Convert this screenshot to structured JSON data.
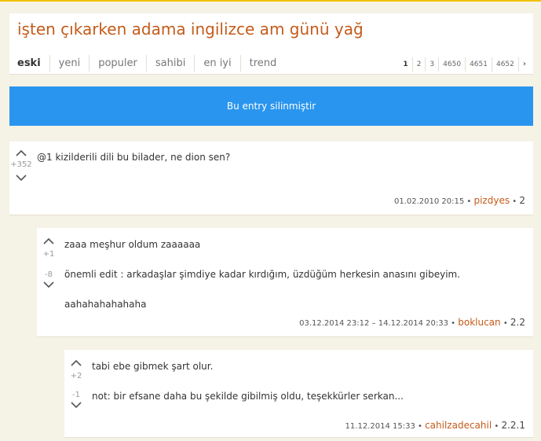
{
  "title": "işten çıkarken adama ingilizce am günü yağ",
  "tabs": [
    "eski",
    "yeni",
    "populer",
    "sahibi",
    "en iyi",
    "trend"
  ],
  "pagination": [
    "1",
    "2",
    "3",
    "4650",
    "4651",
    "4652"
  ],
  "deleted_notice": "Bu entry silinmiştir",
  "entries": [
    {
      "up_count": "+352",
      "lines": [
        "@1 kizilderili dili bu bilader, ne dion sen?"
      ],
      "date": "01.02.2010 20:15",
      "author": "pizdyes",
      "ref": "2"
    },
    {
      "up_count": "+1",
      "down_count": "-8",
      "lines": [
        "zaaa meşhur oldum zaaaaaa",
        "önemli edit : arkadaşlar şimdiye kadar kırdığım, üzdüğüm herkesin anasını gibeyim.",
        "aahahahahahaha"
      ],
      "date": "03.12.2014 23:12 – 14.12.2014 20:33",
      "author": "boklucan",
      "ref": "2.2"
    },
    {
      "up_count": "+2",
      "down_count": "-1",
      "lines": [
        "tabi ebe gibmek şart olur.",
        "not: bir efsane daha bu şekilde gibilmiş oldu, teşekkürler serkan..."
      ],
      "date": "11.12.2014 15:33",
      "author": "cahilzadecahil",
      "ref": "2.2.1"
    }
  ]
}
